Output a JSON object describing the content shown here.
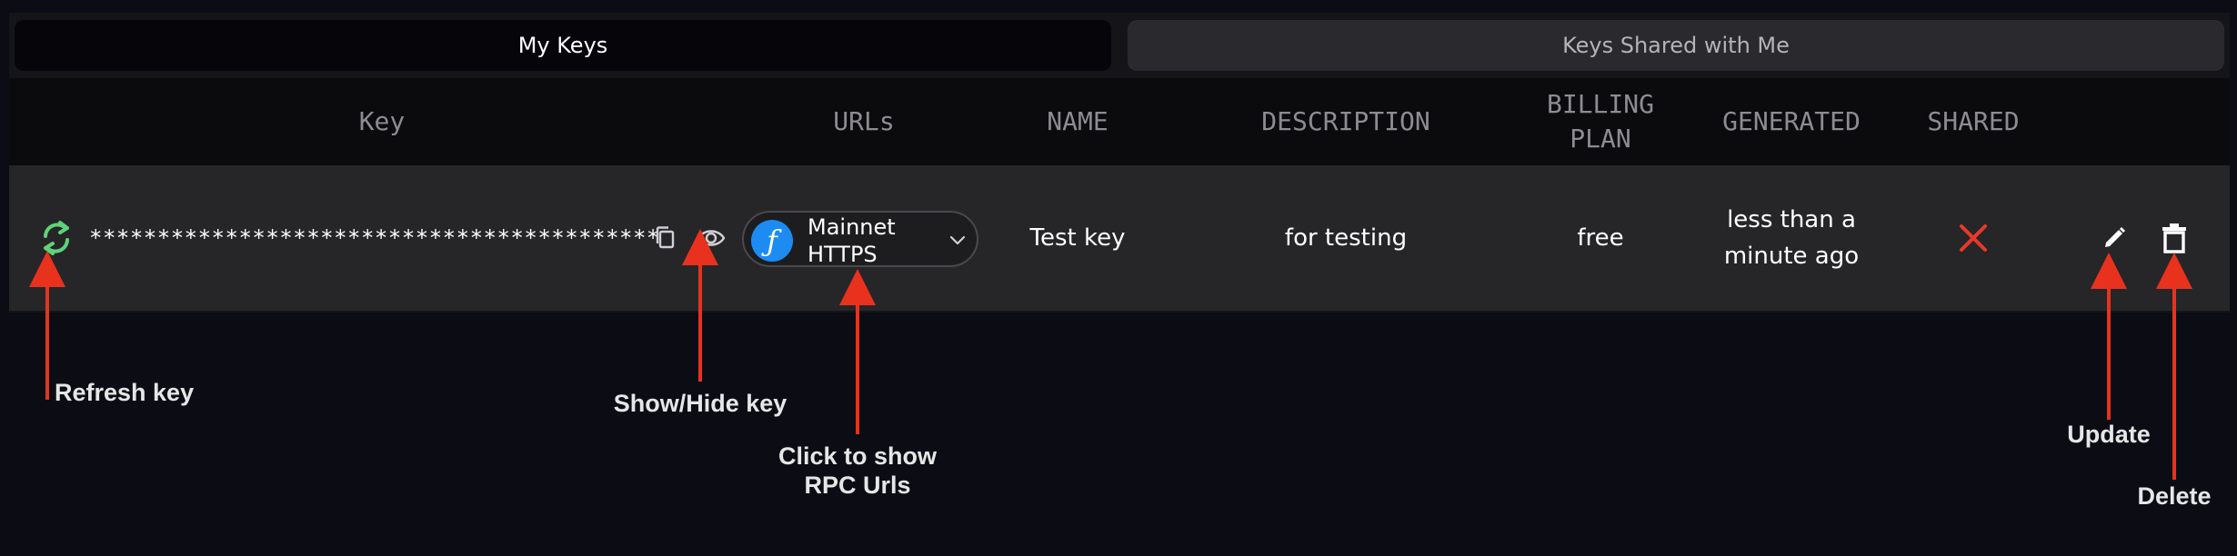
{
  "tabs": [
    {
      "label": "My Keys",
      "active": true
    },
    {
      "label": "Keys Shared with Me",
      "active": false
    }
  ],
  "table": {
    "headers": {
      "key": "Key",
      "urls": "URLs",
      "name": "NAME",
      "description": "DESCRIPTION",
      "billing": "BILLING\nPLAN",
      "generated": "GENERATED",
      "shared": "SHARED"
    },
    "row": {
      "key_masked": "******************************************",
      "url_selected": "Mainnet HTTPS",
      "name": "Test key",
      "description": "for testing",
      "billing_plan": "free",
      "generated": "less than a minute ago",
      "shared": false
    }
  },
  "icons": {
    "refresh": "refresh-icon",
    "copy": "copy-icon",
    "eye": "eye-icon",
    "filecoin": "filecoin-logo-icon",
    "chevron": "chevron-down-icon",
    "shared_no": "close-icon",
    "edit": "pencil-icon",
    "delete": "trash-icon"
  },
  "annotations": {
    "refresh": "Refresh key",
    "show_hide": "Show/Hide key",
    "urls": "Click to show RPC Urls",
    "update": "Update",
    "delete": "Delete"
  },
  "colors": {
    "refresh_icon": "#5fd37a",
    "filecoin_logo": "#1c8cf2",
    "shared_no": "#e8382c",
    "arrow": "#e8321e"
  }
}
